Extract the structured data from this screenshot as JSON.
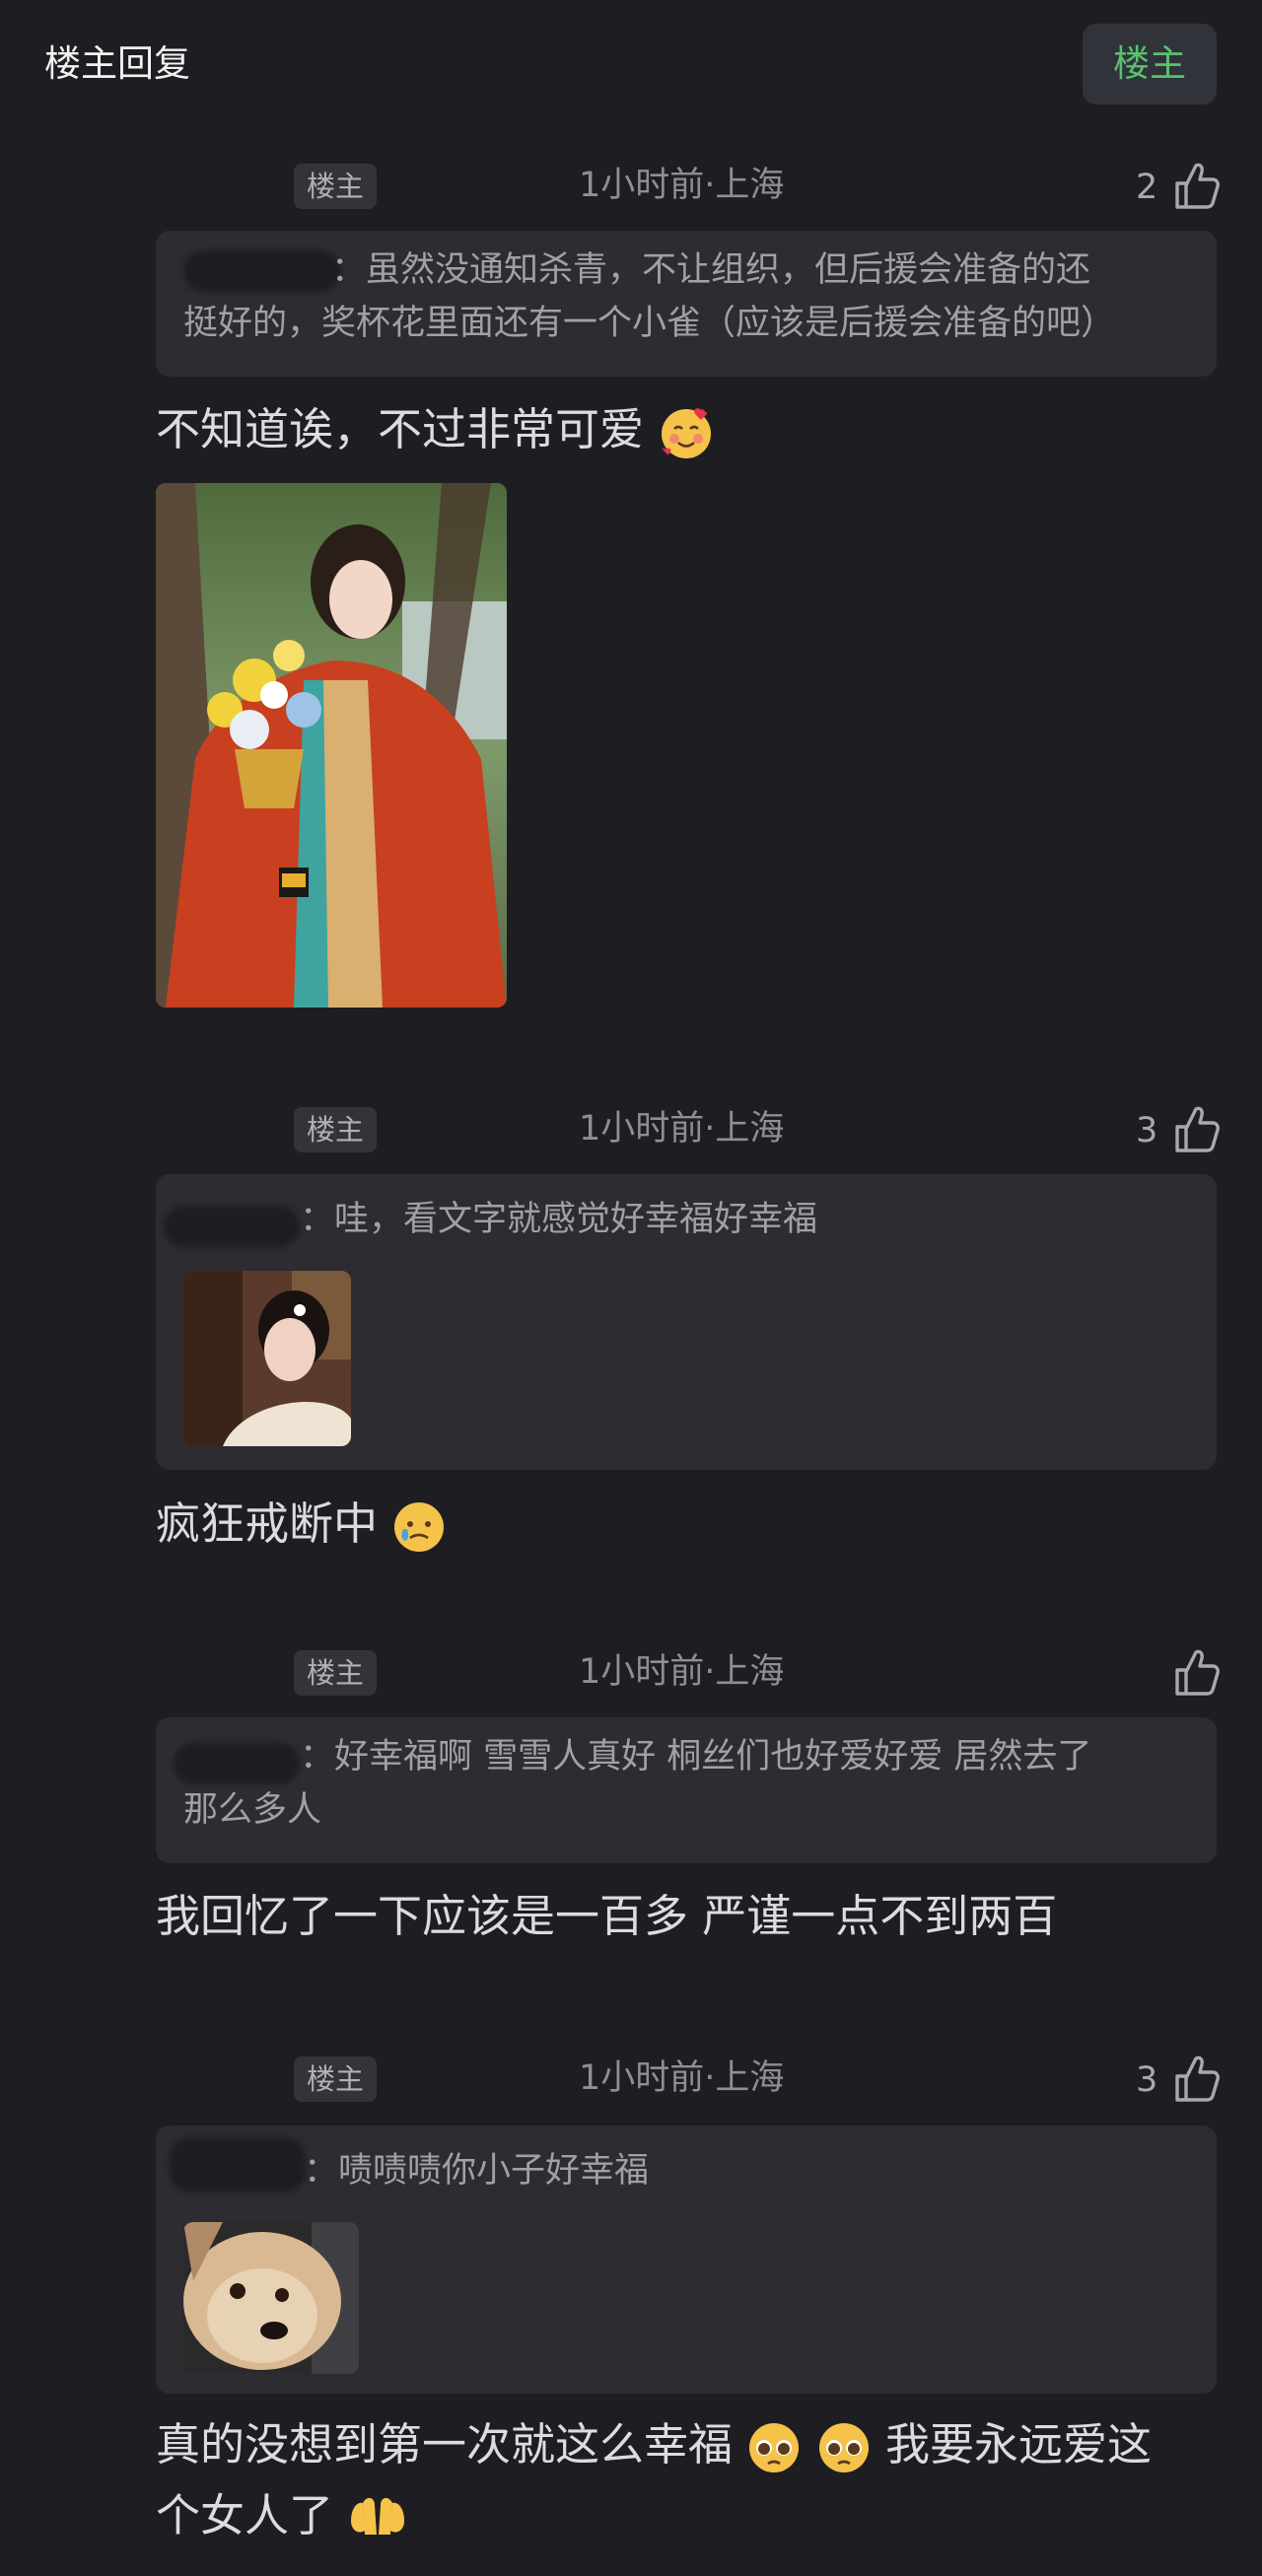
{
  "header": {
    "title": "楼主回复",
    "filter_label": "楼主"
  },
  "replies": [
    {
      "badge": "楼主",
      "time": "1小时前·上海",
      "likes": "2",
      "quote": {
        "text_line1": "：虽然没通知杀青，不让组织，但后援会准备的还",
        "text_line2": "挺好的，奖杯花里面还有一个小雀（应该是后援会准备的吧）"
      },
      "text": "不知道诶，不过非常可爱",
      "emoji": [
        "smiling-face-with-hearts"
      ]
    },
    {
      "badge": "楼主",
      "time": "1小时前·上海",
      "likes": "3",
      "quote": {
        "text_line1": "：哇，看文字就感觉好幸福好幸福"
      },
      "text": "疯狂戒断中",
      "emoji": [
        "face-holding-back-tears"
      ]
    },
    {
      "badge": "楼主",
      "time": "1小时前·上海",
      "likes": "",
      "quote": {
        "text_line1": "：好幸福啊 雪雪人真好  桐丝们也好爱好爱  居然去了",
        "text_line2": "那么多人"
      },
      "text": "我回忆了一下应该是一百多 严谨一点不到两百",
      "emoji": []
    },
    {
      "badge": "楼主",
      "time": "1小时前·上海",
      "likes": "3",
      "quote": {
        "text_line1": "：啧啧啧你小子好幸福"
      },
      "text_line1": "真的没想到第一次就这么幸福",
      "text_line1_after": "我要永远爱这",
      "text_line2": "个女人了",
      "emoji": [
        "pleading-face",
        "pleading-face",
        "palms-up-together"
      ]
    }
  ],
  "colors": {
    "background": "#1e1e22",
    "quote_background": "#2c2c31",
    "accent_green": "#5ac06e"
  }
}
